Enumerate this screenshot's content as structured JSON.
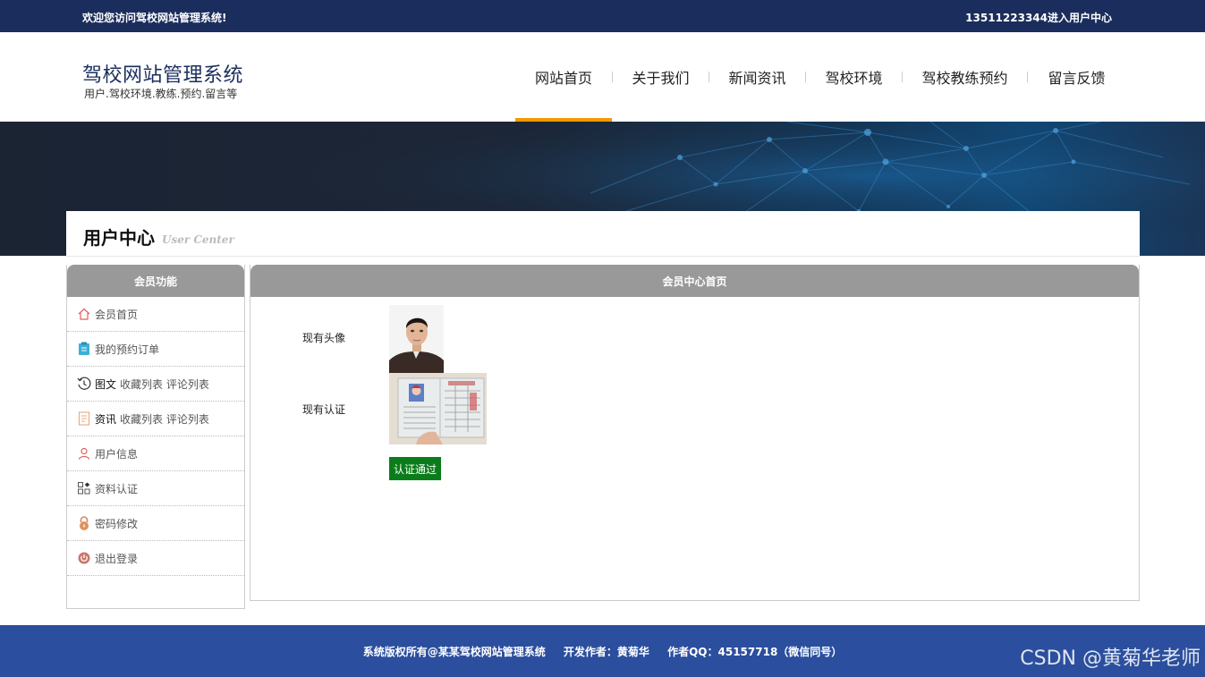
{
  "topbar": {
    "welcome": "欢迎您访问驾校网站管理系统!",
    "user_link": "13511223344进入用户中心"
  },
  "header": {
    "title": "驾校网站管理系统",
    "subtitle": "用户.驾校环境.教练.预约.留言等"
  },
  "nav": {
    "items": [
      {
        "label": "网站首页",
        "active": true
      },
      {
        "label": "关于我们"
      },
      {
        "label": "新闻资讯"
      },
      {
        "label": "驾校环境"
      },
      {
        "label": "驾校教练预约"
      },
      {
        "label": "留言反馈"
      }
    ]
  },
  "user_center": {
    "title": "用户中心",
    "title_en": "User Center"
  },
  "sidebar": {
    "heading": "会员功能",
    "items": [
      {
        "icon": "home-icon",
        "label": "会员首页"
      },
      {
        "icon": "clipboard-icon",
        "label": "我的预约订单"
      },
      {
        "icon": "history-icon",
        "strong": "图文",
        "label": "收藏列表 评论列表"
      },
      {
        "icon": "document-icon",
        "strong": "资讯",
        "label": "收藏列表 评论列表"
      },
      {
        "icon": "user-icon",
        "label": "用户信息"
      },
      {
        "icon": "grid-icon",
        "label": "资料认证"
      },
      {
        "icon": "lock-icon",
        "label": "密码修改"
      },
      {
        "icon": "power-icon",
        "label": "退出登录"
      }
    ]
  },
  "main": {
    "heading": "会员中心首页",
    "avatar_label": "现有头像",
    "cert_label": "现有认证",
    "status": "认证通过"
  },
  "footer": {
    "copyright": "系统版权所有@某某驾校网站管理系统",
    "author": "开发作者：黄菊华",
    "qq": "作者QQ：45157718（微信同号）"
  },
  "watermark": "CSDN @黄菊华老师",
  "colors": {
    "topbar": "#1a2d5c",
    "accent": "#f39800",
    "panel_head": "#999999",
    "footer": "#2b4f9e",
    "status": "#0a7d1a"
  }
}
